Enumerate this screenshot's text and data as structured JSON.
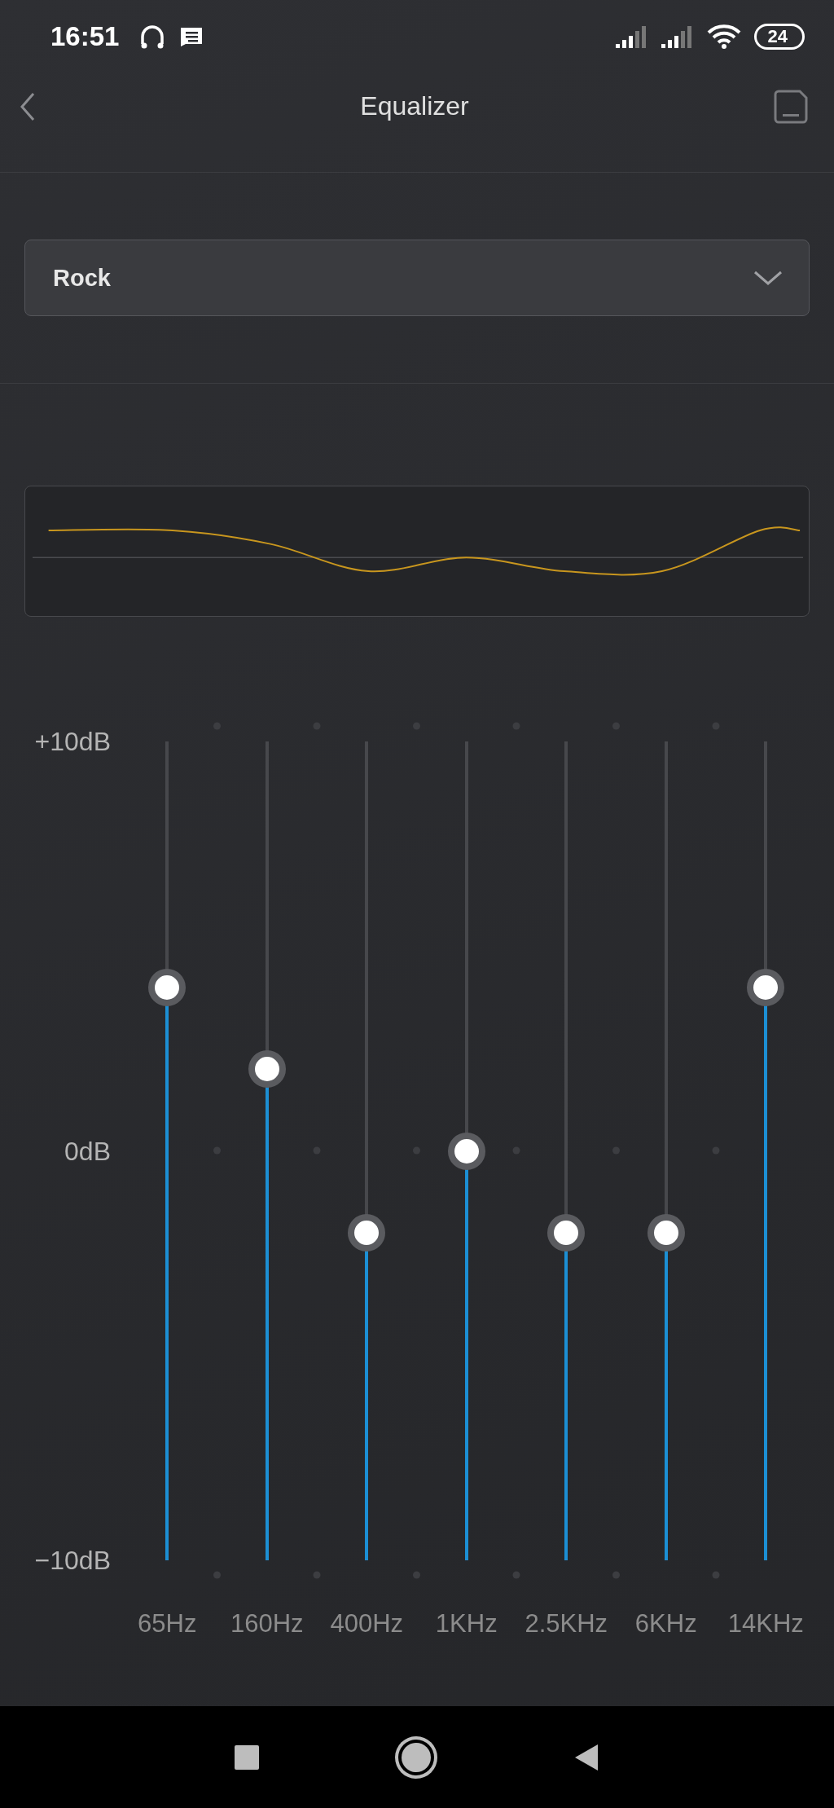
{
  "status_bar": {
    "time": "16:51",
    "battery": "24"
  },
  "header": {
    "title": "Equalizer"
  },
  "preset": {
    "value": "Rock"
  },
  "scale": {
    "top": "+10dB",
    "middle": "0dB",
    "bottom": "−10dB"
  },
  "bands": [
    {
      "label": "65Hz",
      "level": 0.7
    },
    {
      "label": "160Hz",
      "level": 0.6
    },
    {
      "label": "400Hz",
      "level": 0.4
    },
    {
      "label": "1KHz",
      "level": 0.5
    },
    {
      "label": "2.5KHz",
      "level": 0.4
    },
    {
      "label": "6KHz",
      "level": 0.4
    },
    {
      "label": "14KHz",
      "level": 0.7
    }
  ]
}
